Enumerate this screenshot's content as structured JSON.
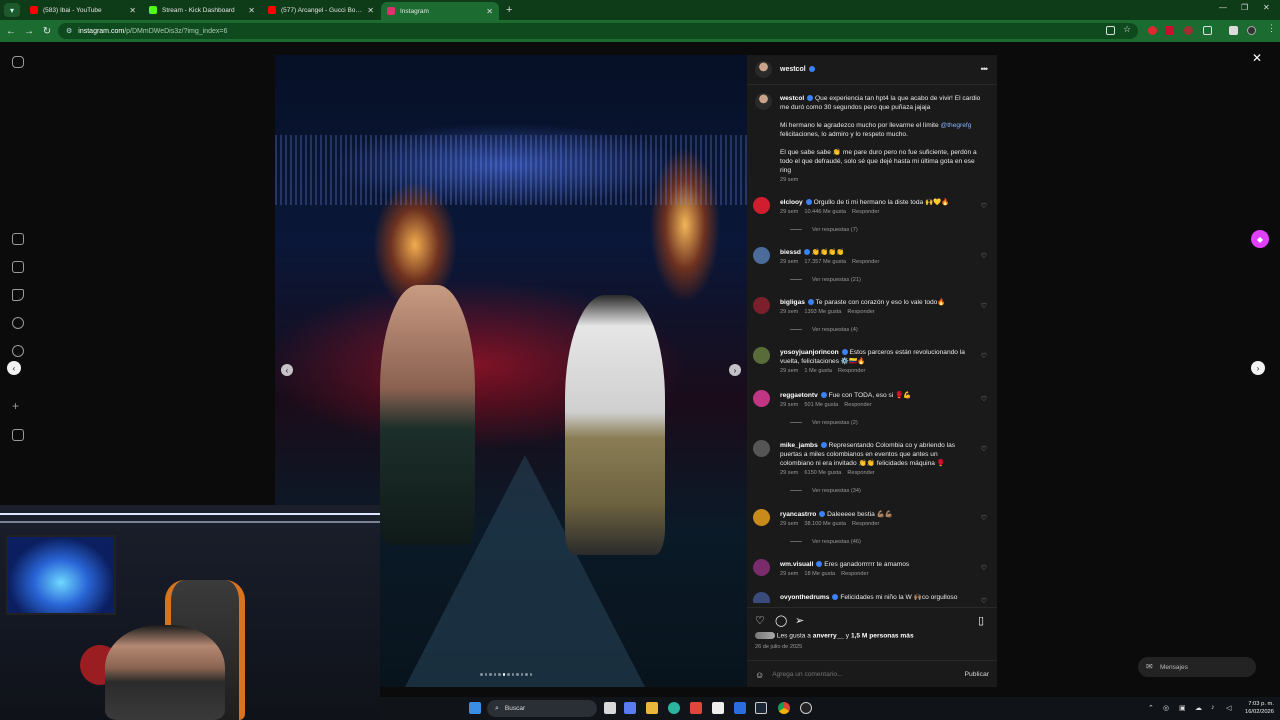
{
  "browser": {
    "tabs": [
      {
        "title": "(583) Ibai - YouTube",
        "color": "#ff0000"
      },
      {
        "title": "Stream - Kick Dashboard",
        "color": "#53fc18"
      },
      {
        "title": "(577) Arcangel - Gucci Boys Ch",
        "color": "#ff0000"
      },
      {
        "title": "Instagram",
        "color": "#e1306c",
        "active": true
      }
    ],
    "url_host": "instagram.com",
    "url_path": "/p/DMmDWeDis3z/?img_index=6"
  },
  "post": {
    "username": "westcol",
    "caption_p1": "Que experiencia tan hpt4 la que acabo de vivir! El cardio me duró como 30 segundos pero que puñaza jajaja",
    "caption_p2_pre": "Mi hermano le agradezco mucho por llevarme el límite",
    "caption_mention": "@thegrefg",
    "caption_p2_post": "felicitaciones, lo admiro y lo respeto mucho.",
    "caption_p3": "El que sabe sabe 👏 me pare duro pero no fue suficiente, perdón a todo el que defraudé, solo sé que dejé hasta mi última gota en ese ring",
    "caption_time": "29 sem",
    "likes_prefix": "Les gusta a",
    "likes_user": "anverry__",
    "likes_mid": "y",
    "likes_count": "1,5 M personas más",
    "date": "26 de julio de 2025",
    "comment_placeholder": "Agrega un comentario...",
    "publish_label": "Publicar",
    "more_label": "•••",
    "carousel_dots": 12,
    "carousel_active": 5
  },
  "comments": [
    {
      "user": "elclooy",
      "text": "Orgullo de ti mi hermano la diste toda 🙌💛🔥",
      "time": "29 sem",
      "likes": "10.446 Me gusta",
      "reply": "Responder",
      "replies": "Ver respuestas (7)",
      "color": "#d11e2e"
    },
    {
      "user": "biessd",
      "text": "👏👏👏👏",
      "time": "29 sem",
      "likes": "17.357 Me gusta",
      "reply": "Responder",
      "replies": "Ver respuestas (21)",
      "color": "#4b6b9a"
    },
    {
      "user": "bigligas",
      "text": "Te paraste con corazón y eso lo vale todo🔥",
      "time": "29 sem",
      "likes": "1393 Me gusta",
      "reply": "Responder",
      "replies": "Ver respuestas (4)",
      "color": "#7a1f2b"
    },
    {
      "user": "yosoyjuanjorincon",
      "text": "Estos parceros están revolucionando la vuelta, felicitaciones ⚙️🇨🇴🔥",
      "time": "29 sem",
      "likes": "1 Me gusta",
      "reply": "Responder",
      "replies": "",
      "color": "#5a6b3a"
    },
    {
      "user": "reggaetontv",
      "text": "Fue con TODA, eso si 🥊💪",
      "time": "29 sem",
      "likes": "501 Me gusta",
      "reply": "Responder",
      "replies": "Ver respuestas (2)",
      "color": "#c13584"
    },
    {
      "user": "mike_jambs",
      "text": "Representando Colombia co y abriendo las puertas a miles colombianos en eventos que antes un colombiano ni era invitado 👏👏 felicidades máquina 🥊",
      "time": "29 sem",
      "likes": "6150 Me gusta",
      "reply": "Responder",
      "replies": "Ver respuestas (34)",
      "color": "#555555"
    },
    {
      "user": "ryancastrro",
      "text": "Daleeeee bestia 💪🏽💪🏽",
      "time": "29 sem",
      "likes": "38.100 Me gusta",
      "reply": "Responder",
      "replies": "Ver respuestas (46)",
      "color": "#c88a1a"
    },
    {
      "user": "wm.visuall",
      "text": "Eres ganadorrrrrr te amamos",
      "time": "29 sem",
      "likes": "18 Me gusta",
      "reply": "Responder",
      "replies": "",
      "color": "#7a2b6b"
    },
    {
      "user": "ovyonthedrums",
      "text": "Felicidades mi niño la W 🙌🏽co orgulloso",
      "time": "",
      "likes": "",
      "reply": "",
      "replies": "",
      "color": "#3a4a7a"
    }
  ],
  "overlay": {
    "messages_label": "Mensajes"
  },
  "taskbar": {
    "search_placeholder": "Buscar",
    "time": "7:03 p. m.",
    "date": "16/02/2026"
  }
}
